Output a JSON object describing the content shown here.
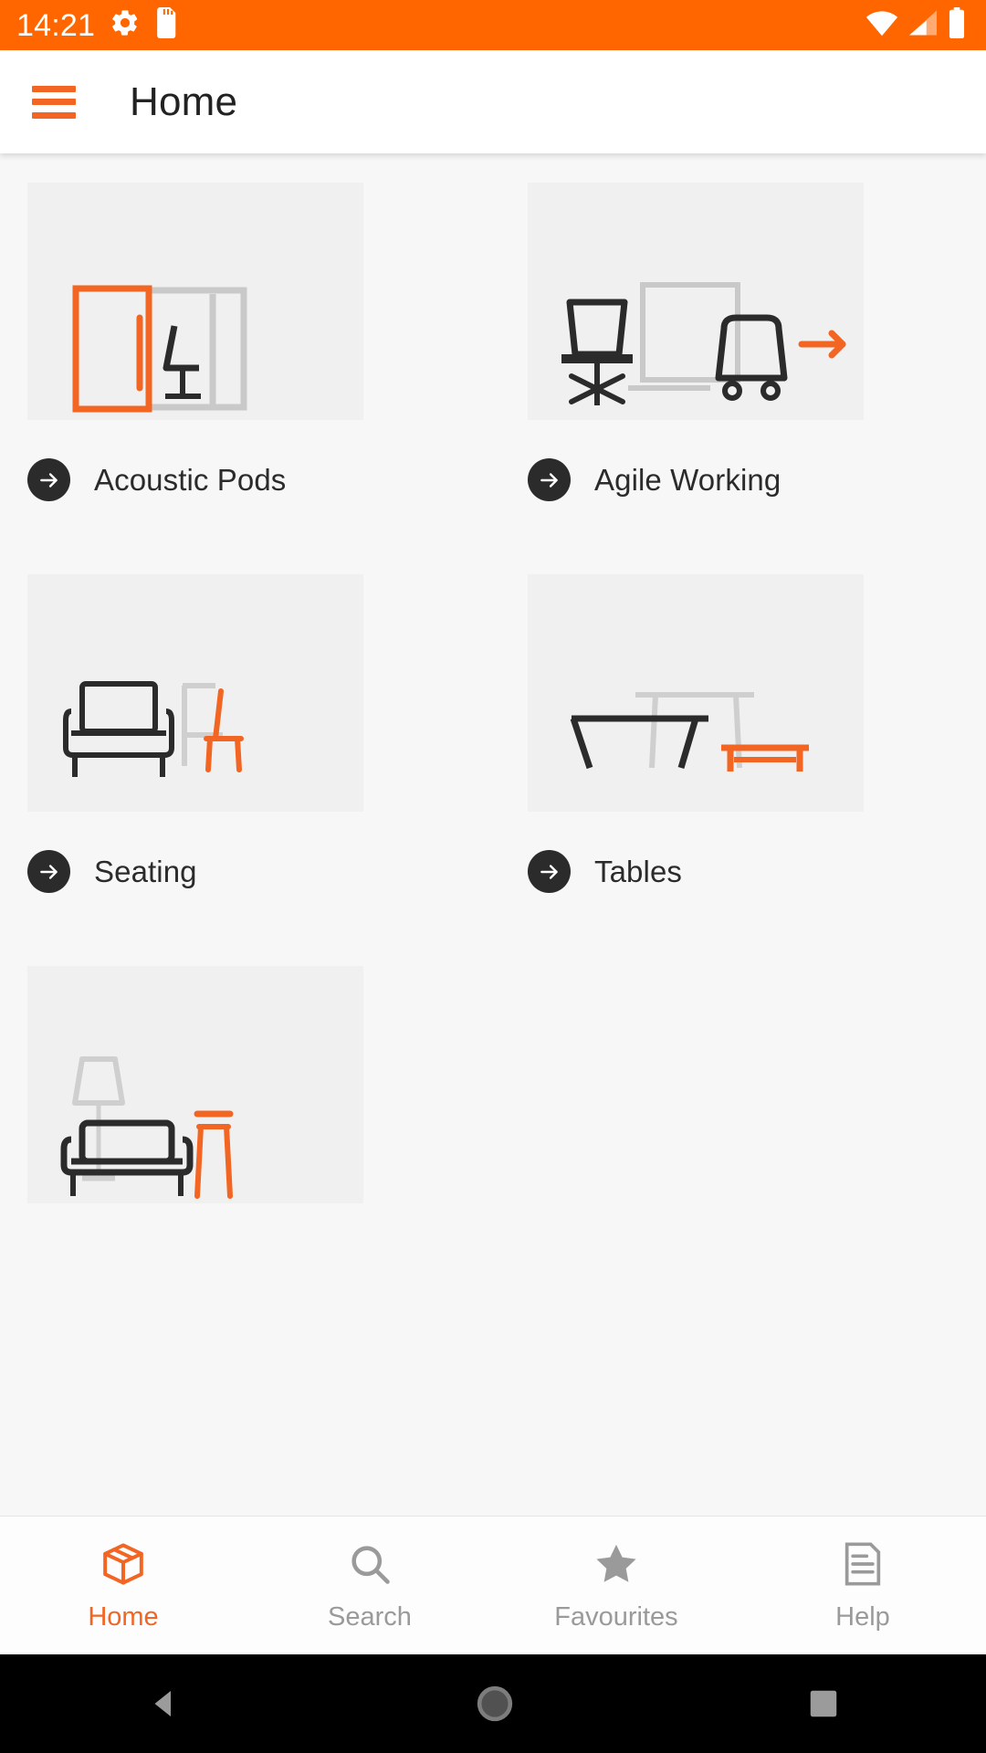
{
  "status_bar": {
    "time": "14:21",
    "background_color": "#FF6600",
    "icons": [
      "gear-icon",
      "sd-card-icon"
    ],
    "right_icons": [
      "wifi-icon",
      "cellular-signal-icon",
      "battery-icon"
    ]
  },
  "app_bar": {
    "menu_icon": "hamburger-menu-icon",
    "title": "Home",
    "accent_color": "#F26522"
  },
  "categories": [
    {
      "label": "Acoustic Pods",
      "illustration": "acoustic-pod-illustration"
    },
    {
      "label": "Agile Working",
      "illustration": "agile-working-illustration"
    },
    {
      "label": "Seating",
      "illustration": "seating-illustration"
    },
    {
      "label": "Tables",
      "illustration": "tables-illustration"
    },
    {
      "label": "",
      "illustration": "lounge-illustration"
    }
  ],
  "tabs": [
    {
      "label": "Home",
      "icon": "box-icon",
      "active": true
    },
    {
      "label": "Search",
      "icon": "search-icon",
      "active": false
    },
    {
      "label": "Favourites",
      "icon": "star-icon",
      "active": false
    },
    {
      "label": "Help",
      "icon": "document-icon",
      "active": false
    }
  ],
  "nav_bar": {
    "back": "back-triangle-icon",
    "home": "home-circle-icon",
    "recents": "recents-square-icon"
  },
  "colors": {
    "orange": "#F26522",
    "status_orange": "#FF6600",
    "dark": "#2b2b2b",
    "tile_bg": "#f0f0f0",
    "page_bg": "#f7f7f7",
    "muted": "#9a9a9a"
  }
}
